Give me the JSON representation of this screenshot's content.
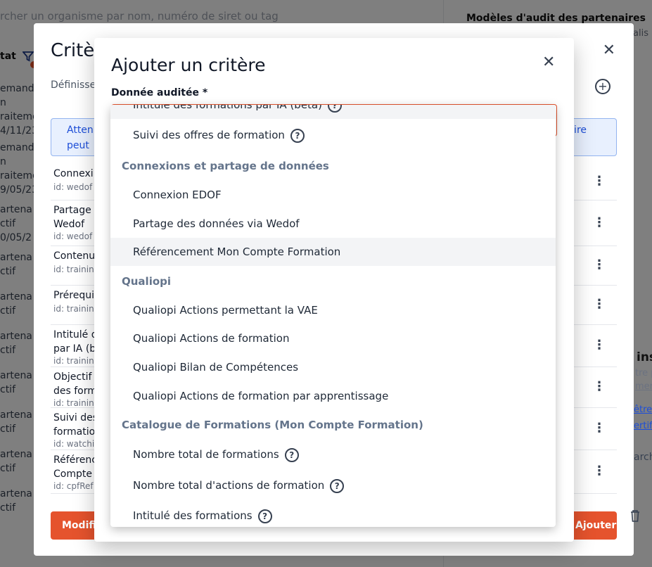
{
  "background": {
    "search_placeholder": "rcher un organisme par nom, numéro de siret ou tag",
    "filter_label": "tat",
    "left_rows": [
      "emand",
      "n",
      "raiteme",
      "4/11/23",
      "emand",
      "n",
      "raiteme",
      "9/05/23",
      "artena",
      "ctif",
      "0/05/2",
      "artena",
      "ctif",
      "artena",
      "ctif",
      "artena",
      "ctif",
      "artena",
      "ctif",
      "artena",
      "ctif",
      "artena",
      "ctif",
      "artena",
      "ctif"
    ],
    "right_title": "Modèles d'audit des partenaires",
    "right_sub": "alis",
    "right_peek": [
      "ins",
      "tre p",
      "men",
      "être",
      "ertifi",
      "arch"
    ]
  },
  "criteria_dialog": {
    "title": "Critère",
    "description": "Définisse",
    "alert_line1": "Atten",
    "alert_line2": "peut",
    "alert_right": "aire",
    "items": [
      {
        "l1": "Connexi",
        "l2": "",
        "l3": "id: wedof"
      },
      {
        "l1": "Partage",
        "l2": "Wedof",
        "l3": "id: wedof"
      },
      {
        "l1": "Contenu",
        "l2": "",
        "l3": "id: trainin"
      },
      {
        "l1": "Prérequi",
        "l2": "",
        "l3": "id: trainin"
      },
      {
        "l1": "Intitulé d",
        "l2": "par IA (b",
        "l3": "id: trainin"
      },
      {
        "l1": "Objectif",
        "l2": "des form",
        "l3": "id: trainin"
      },
      {
        "l1": "Suivi des",
        "l2": "formatio",
        "l3": "id: watchi"
      },
      {
        "l1": "Référenc",
        "l2": "Compte",
        "l3": "id: cpfRef"
      }
    ],
    "modify_button": "Modifier",
    "add_button": "Ajouter un critère"
  },
  "add_dialog": {
    "title": "Ajouter un critère",
    "field_label": "Donnée auditée *",
    "close": "✕"
  },
  "dropdown": {
    "partial_top": "Intitulé des formations par IA (beta)",
    "item_suivi": "Suivi des offres de formation",
    "group_connexions": "Connexions et partage de données",
    "item_connexion_edof": "Connexion EDOF",
    "item_partage": "Partage des données via Wedof",
    "item_referencement": "Référencement Mon Compte Formation",
    "group_qualiopi": "Qualiopi",
    "item_q_vae": "Qualiopi Actions permettant la VAE",
    "item_q_actions": "Qualiopi Actions de formation",
    "item_q_bilan": "Qualiopi Bilan de Compétences",
    "item_q_apprentissage": "Qualiopi Actions de formation par apprentissage",
    "group_catalogue": "Catalogue de Formations (Mon Compte Formation)",
    "item_nb_formations": "Nombre total de formations",
    "item_nb_actions": "Nombre total d'actions de formation",
    "item_intitule": "Intitulé des formations",
    "help_glyph": "?"
  },
  "colors": {
    "accent": "#e5532d",
    "group_text": "#64748b",
    "highlight_row": "#f3f4f6"
  }
}
